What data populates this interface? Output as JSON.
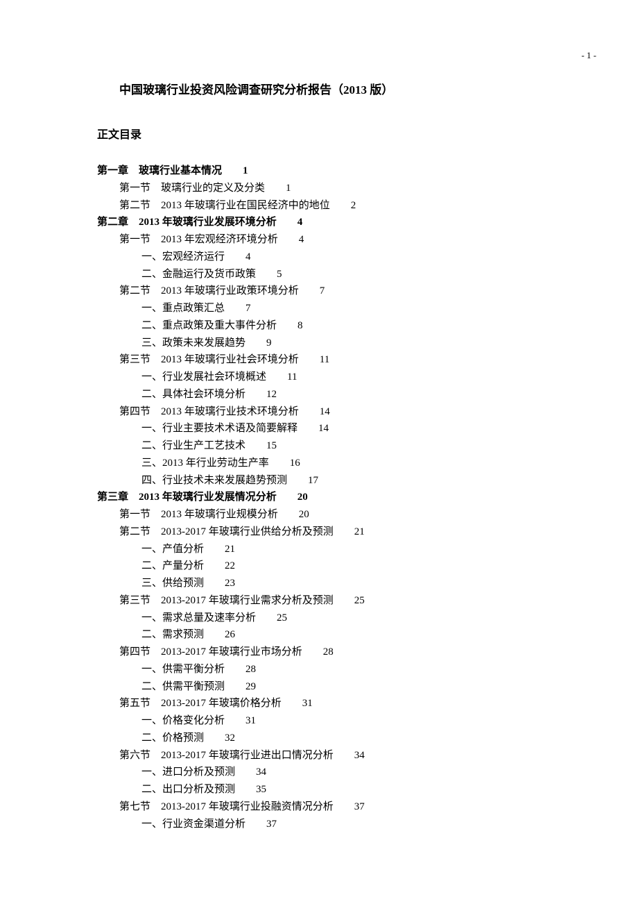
{
  "page_number": "- 1 -",
  "title": "中国玻璃行业投资风险调查研究分析报告（2013 版）",
  "subtitle": "正文目录",
  "toc": [
    {
      "level": "chapter",
      "text": "第一章　玻璃行业基本情况",
      "page": "1"
    },
    {
      "level": "section",
      "text": "第一节　玻璃行业的定义及分类",
      "page": "1"
    },
    {
      "level": "section",
      "text": "第二节　2013 年玻璃行业在国民经济中的地位",
      "page": "2"
    },
    {
      "level": "chapter",
      "text": "第二章　2013 年玻璃行业发展环境分析",
      "page": "4"
    },
    {
      "level": "section",
      "text": "第一节　2013 年宏观经济环境分析",
      "page": "4"
    },
    {
      "level": "subsection",
      "text": "一、宏观经济运行",
      "page": "4"
    },
    {
      "level": "subsection",
      "text": "二、金融运行及货币政策",
      "page": "5"
    },
    {
      "level": "section",
      "text": "第二节　2013 年玻璃行业政策环境分析",
      "page": "7"
    },
    {
      "level": "subsection",
      "text": "一、重点政策汇总",
      "page": "7"
    },
    {
      "level": "subsection",
      "text": "二、重点政策及重大事件分析",
      "page": "8"
    },
    {
      "level": "subsection",
      "text": "三、政策未来发展趋势",
      "page": "9"
    },
    {
      "level": "section",
      "text": "第三节　2013 年玻璃行业社会环境分析",
      "page": "11"
    },
    {
      "level": "subsection",
      "text": "一、行业发展社会环境概述",
      "page": "11"
    },
    {
      "level": "subsection",
      "text": "二、具体社会环境分析",
      "page": "12"
    },
    {
      "level": "section",
      "text": "第四节　2013 年玻璃行业技术环境分析",
      "page": "14"
    },
    {
      "level": "subsection",
      "text": "一、行业主要技术术语及简要解释",
      "page": "14"
    },
    {
      "level": "subsection",
      "text": "二、行业生产工艺技术",
      "page": "15"
    },
    {
      "level": "subsection",
      "text": "三、2013 年行业劳动生产率",
      "page": "16"
    },
    {
      "level": "subsection",
      "text": "四、行业技术未来发展趋势预测",
      "page": "17"
    },
    {
      "level": "chapter",
      "text": "第三章　2013 年玻璃行业发展情况分析",
      "page": "20"
    },
    {
      "level": "section",
      "text": "第一节　2013 年玻璃行业规模分析",
      "page": "20"
    },
    {
      "level": "section",
      "text": "第二节　2013-2017 年玻璃行业供给分析及预测",
      "page": "21"
    },
    {
      "level": "subsection",
      "text": "一、产值分析",
      "page": "21"
    },
    {
      "level": "subsection",
      "text": "二、产量分析",
      "page": "22"
    },
    {
      "level": "subsection",
      "text": "三、供给预测",
      "page": "23"
    },
    {
      "level": "section",
      "text": "第三节　2013-2017 年玻璃行业需求分析及预测",
      "page": "25"
    },
    {
      "level": "subsection",
      "text": "一、需求总量及速率分析",
      "page": "25"
    },
    {
      "level": "subsection",
      "text": "二、需求预测",
      "page": "26"
    },
    {
      "level": "section",
      "text": "第四节　2013-2017 年玻璃行业市场分析",
      "page": "28"
    },
    {
      "level": "subsection",
      "text": "一、供需平衡分析",
      "page": "28"
    },
    {
      "level": "subsection",
      "text": "二、供需平衡预测",
      "page": "29"
    },
    {
      "level": "section",
      "text": "第五节　2013-2017 年玻璃价格分析",
      "page": "31"
    },
    {
      "level": "subsection",
      "text": "一、价格变化分析",
      "page": "31"
    },
    {
      "level": "subsection",
      "text": "二、价格预测",
      "page": "32"
    },
    {
      "level": "section",
      "text": "第六节　2013-2017 年玻璃行业进出口情况分析",
      "page": "34"
    },
    {
      "level": "subsection",
      "text": "一、进口分析及预测",
      "page": "34"
    },
    {
      "level": "subsection",
      "text": "二、出口分析及预测",
      "page": "35"
    },
    {
      "level": "section",
      "text": "第七节　2013-2017 年玻璃行业投融资情况分析",
      "page": "37"
    },
    {
      "level": "subsection",
      "text": "一、行业资金渠道分析",
      "page": "37"
    }
  ]
}
